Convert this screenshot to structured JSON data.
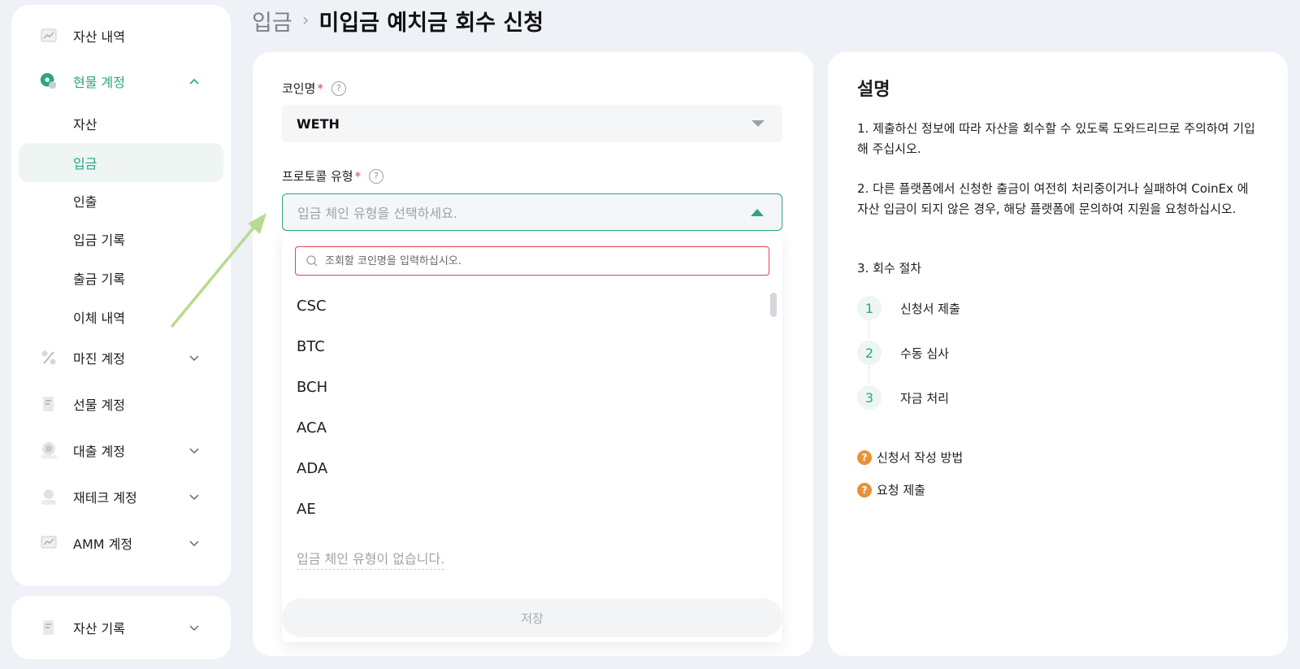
{
  "sidebar": {
    "asset_history": "자산 내역",
    "spot_account": "현물 계정",
    "spot_sub": [
      "자산",
      "입금",
      "인출",
      "입금 기록",
      "출금 기록",
      "이체 내역"
    ],
    "margin_account": "마진 계정",
    "futures_account": "선물 계정",
    "loan_account": "대출 계정",
    "finance_account": "재테크 계정",
    "amm_account": "AMM 계정",
    "asset_records": "자산 기록"
  },
  "breadcrumb": {
    "parent": "입금",
    "current": "미입금 예치금 회수 신청"
  },
  "form": {
    "coin_label": "코인명",
    "coin_value": "WETH",
    "protocol_label": "프로토콜 유형",
    "protocol_placeholder": "입금 체인 유형을 선택하세요.",
    "search_placeholder": "조회할 코인명을 입력하십시오.",
    "options": [
      "CSC",
      "BTC",
      "BCH",
      "ACA",
      "ADA",
      "AE"
    ],
    "empty_note": "입금 체인 유형이 없습니다.",
    "save_label": "저장",
    "required_mark": "*",
    "help_mark": "?"
  },
  "description": {
    "title": "설명",
    "p1": "1. 제출하신 정보에 따라 자산을 회수할 수 있도록 도와드리므로 주의하여 기입해 주십시오.",
    "p2": "2. 다른 플랫폼에서 신청한 출금이 여전히 처리중이거나 실패하여 CoinEx 에 자산 입금이 되지 않은 경우, 해당 플랫폼에 문의하여 지원을 요청하십시오.",
    "p3": "3. 회수 절차",
    "steps": [
      {
        "num": "1",
        "text": "신청서 제출"
      },
      {
        "num": "2",
        "text": "수동 심사"
      },
      {
        "num": "3",
        "text": "자금 처리"
      }
    ],
    "link1": "신청서 작성 방법",
    "link2": "요청 제출"
  },
  "colors": {
    "accent": "#2aa585",
    "error": "#e0454d",
    "help_orange": "#e8913a",
    "arrow": "#b5dc8e"
  }
}
